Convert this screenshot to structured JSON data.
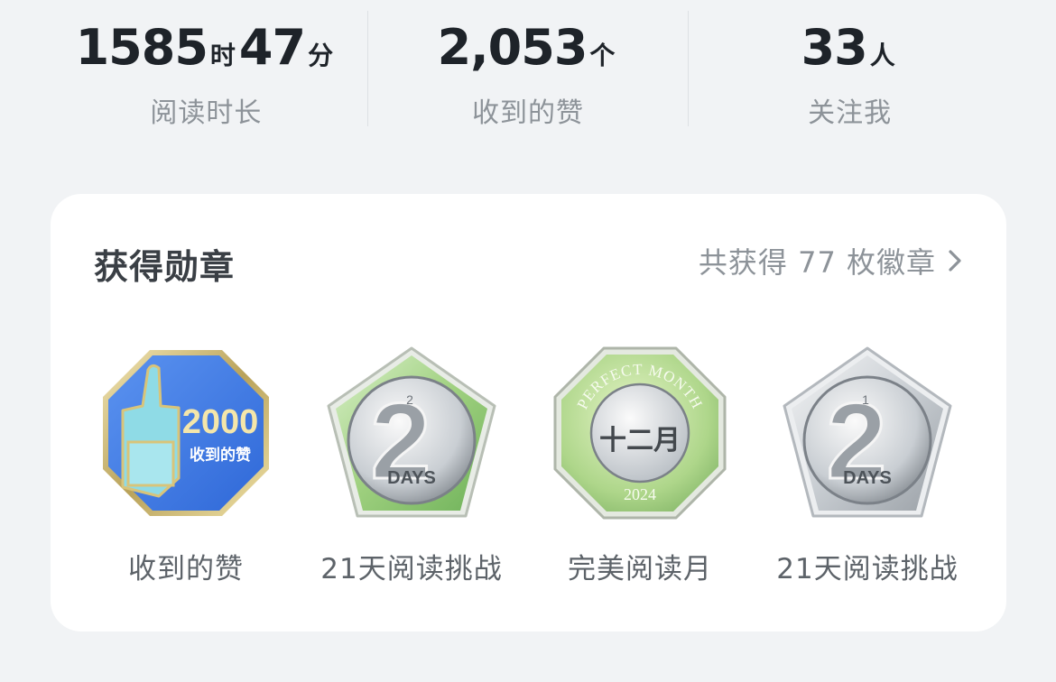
{
  "stats": [
    {
      "parts": [
        {
          "n": "1585",
          "u": "时"
        },
        {
          "n": "47",
          "u": "分"
        }
      ],
      "label": "阅读时长"
    },
    {
      "parts": [
        {
          "n": "2,053",
          "u": "个"
        }
      ],
      "label": "收到的赞"
    },
    {
      "parts": [
        {
          "n": "33",
          "u": "人"
        }
      ],
      "label": "关注我"
    }
  ],
  "card": {
    "title": "获得勋章",
    "link_label": "共获得 77 枚徽章"
  },
  "badges": [
    {
      "label": "收到的赞",
      "art": {
        "count": "2000",
        "caption": "收到的赞"
      }
    },
    {
      "label": "21天阅读挑战",
      "art": {
        "num": "2",
        "days": "DAYS",
        "level": "2"
      }
    },
    {
      "label": "完美阅读月",
      "art": {
        "top": "PERFECT MONTH",
        "month": "十二月",
        "year": "2024"
      }
    },
    {
      "label": "21天阅读挑战",
      "art": {
        "num": "2",
        "days": "DAYS",
        "level": "1"
      }
    }
  ],
  "colors": {
    "background": "#f1f3f5",
    "card": "#ffffff",
    "number_text": "#1e2329",
    "muted_text": "#8d9399",
    "badge_blue": "#3e7be8",
    "badge_cyan": "#7fd3e0",
    "badge_green": "#9fd07f",
    "badge_silver": "#c9ced3"
  }
}
